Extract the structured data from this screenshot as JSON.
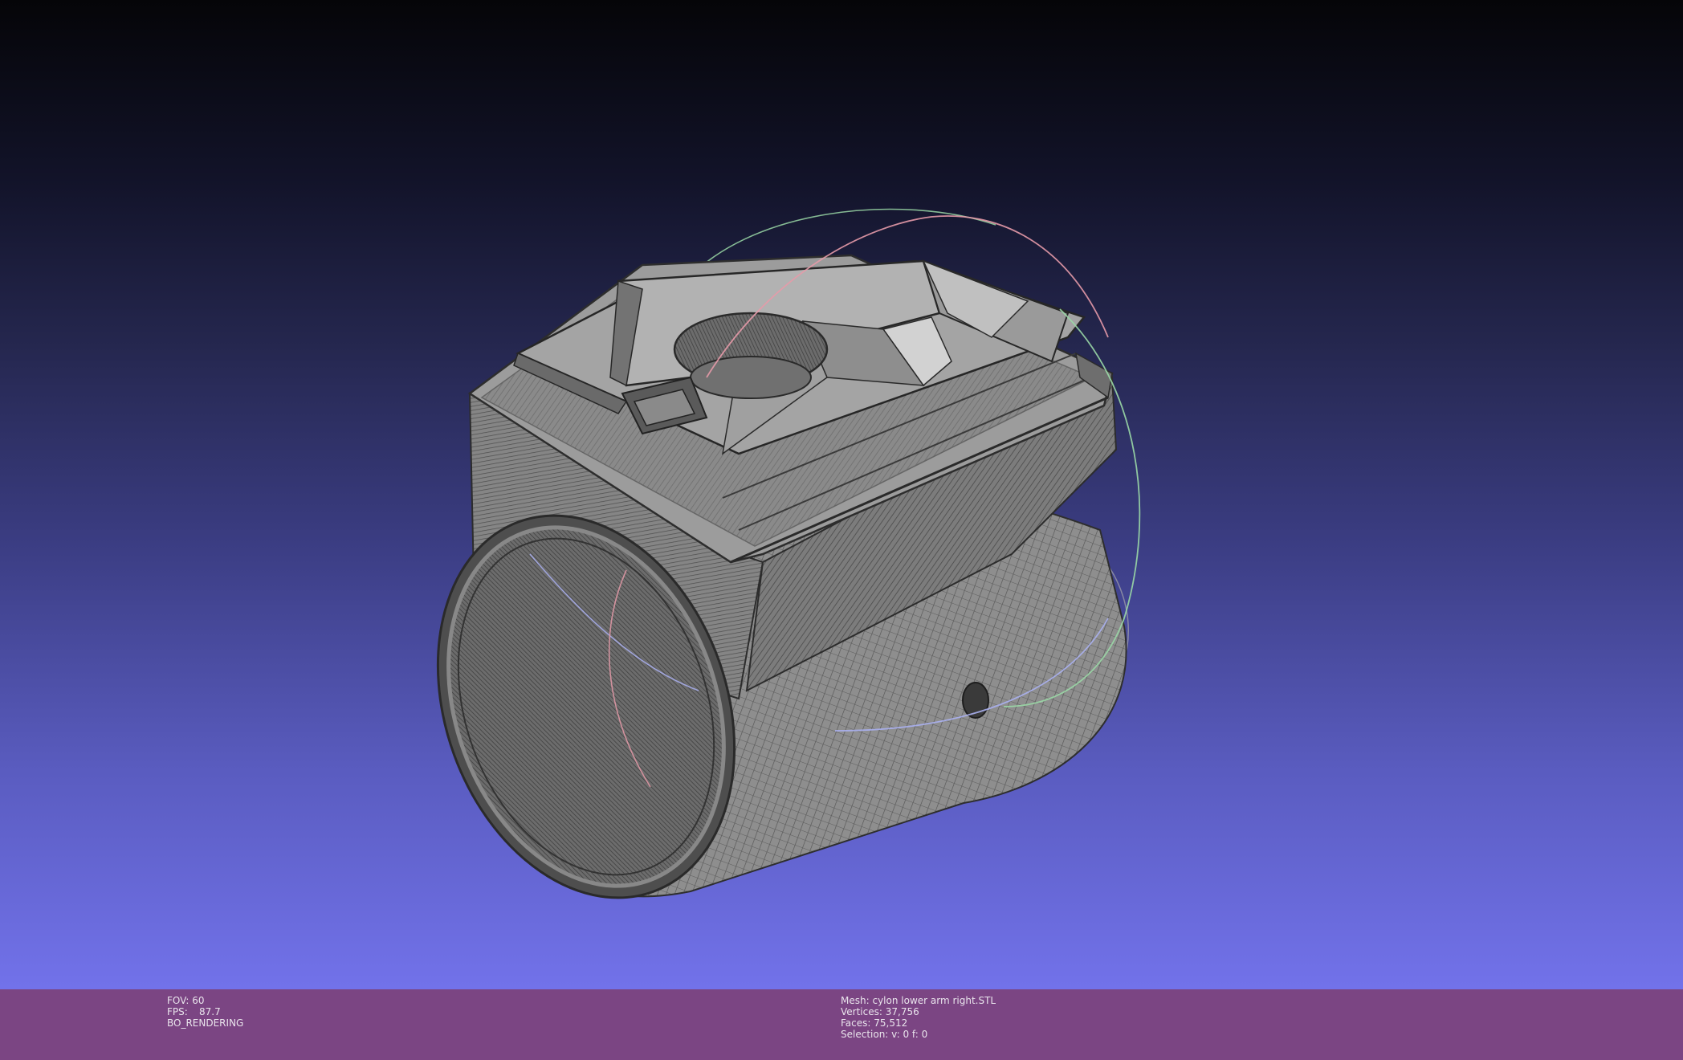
{
  "viewport": {
    "background_top": "#050508",
    "background_bottom": "#7272ea",
    "mesh_color": "#8a8a8a"
  },
  "status_bar": {
    "background": "#7b4583",
    "render_info": {
      "fov_label": "FOV:",
      "fov_value": "60",
      "fps_label": "FPS:",
      "fps_value": "87.7",
      "mode": "BO_RENDERING"
    },
    "mesh_info": {
      "mesh_label": "Mesh:",
      "mesh_name": "cylon lower arm right.STL",
      "vertices_label": "Vertices:",
      "vertices_value": "37,756",
      "faces_label": "Faces:",
      "faces_value": "75,512",
      "selection_label": "Selection:",
      "selection_value": "v: 0 f: 0"
    }
  },
  "trackball": {
    "ring_x_color": "#e59aa8",
    "ring_y_color": "#9ad8a6",
    "ring_z_color": "#aab0f0"
  }
}
